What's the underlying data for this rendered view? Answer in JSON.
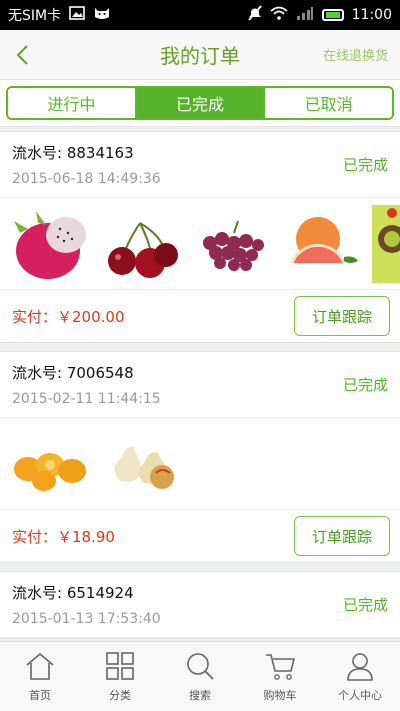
{
  "status_bar": {
    "carrier": "无SIM卡",
    "time": "11:00"
  },
  "header": {
    "title": "我的订单",
    "action": "在线退换货",
    "back_icon": "chevron-left-icon"
  },
  "tabs": [
    {
      "label": "进行中",
      "active": false
    },
    {
      "label": "已完成",
      "active": true
    },
    {
      "label": "已取消",
      "active": false
    }
  ],
  "orders": [
    {
      "serial": "流水号: 8834163",
      "time": "2015-06-18 14:49:36",
      "status": "已完成",
      "items": [
        "dragon-fruit",
        "cherries",
        "grapes",
        "grapefruit",
        "kiwi-box"
      ],
      "paid": "实付：￥200.00",
      "track_label": "订单跟踪"
    },
    {
      "serial": "流水号: 7006548",
      "time": "2015-02-11 11:44:15",
      "status": "已完成",
      "items": [
        "kumquats",
        "pears"
      ],
      "paid": "实付：￥18.90",
      "track_label": "订单跟踪"
    },
    {
      "serial": "流水号: 6514924",
      "time": "2015-01-13 17:53:40",
      "status": "已完成"
    }
  ],
  "bottom_nav": [
    {
      "label": "首页",
      "icon": "home-icon"
    },
    {
      "label": "分类",
      "icon": "grid-icon"
    },
    {
      "label": "搜索",
      "icon": "search-icon"
    },
    {
      "label": "购物车",
      "icon": "cart-icon"
    },
    {
      "label": "个人中心",
      "icon": "user-icon"
    }
  ],
  "colors": {
    "accent": "#55b22a",
    "price": "#d83a1f"
  }
}
